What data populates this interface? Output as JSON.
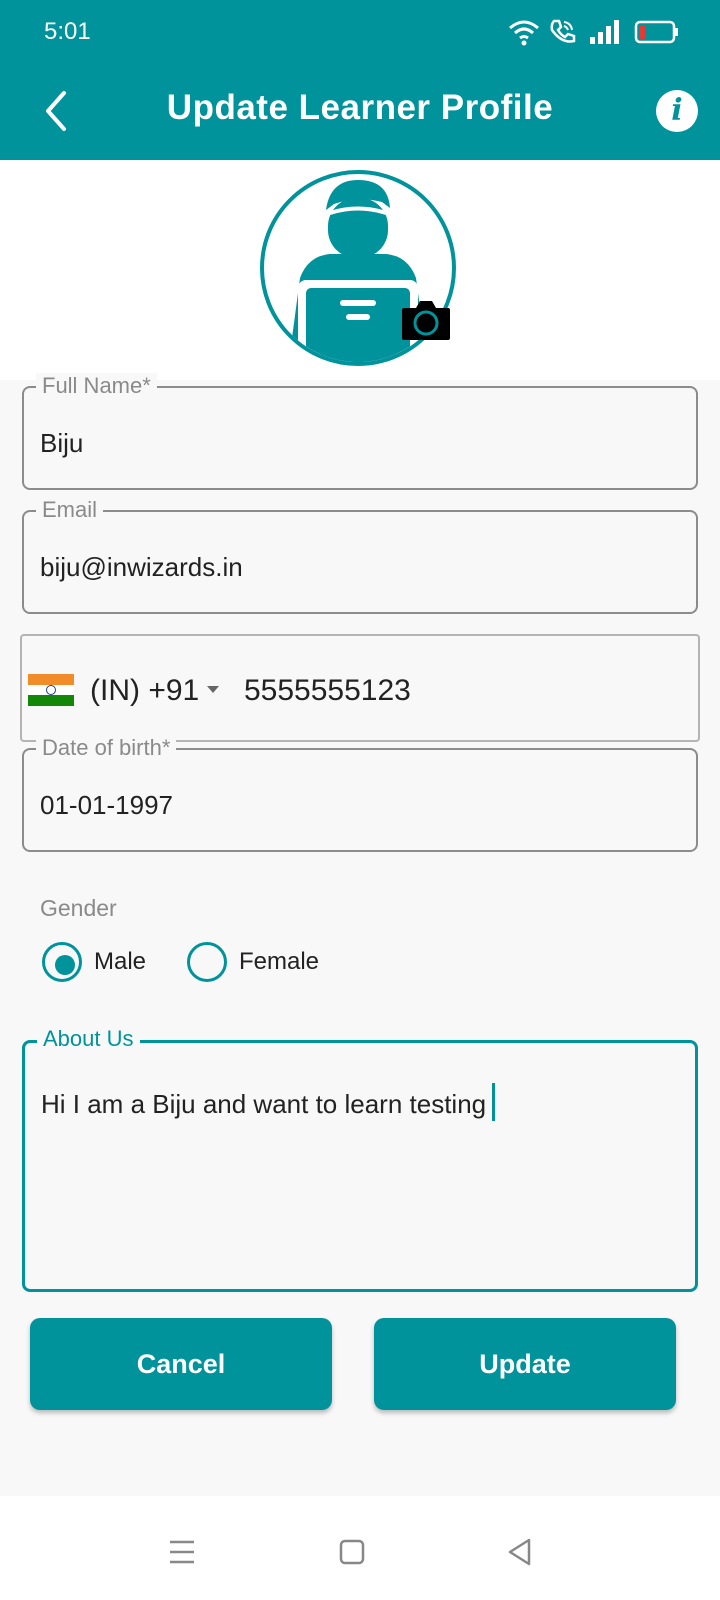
{
  "status_bar": {
    "time": "5:01",
    "icons": [
      "wifi-icon",
      "call-icon",
      "signal-icon",
      "battery-low-icon"
    ]
  },
  "header": {
    "back_icon": "chevron-left-icon",
    "title": "Update Learner Profile",
    "info_icon": "info-icon",
    "info_glyph": "i"
  },
  "profile": {
    "avatar_icon": "user-with-laptop-icon",
    "camera_icon": "camera-icon"
  },
  "form": {
    "full_name": {
      "label": "Full Name*",
      "value": "Biju"
    },
    "email": {
      "label": "Email",
      "value": "biju@inwizards.in"
    },
    "phone": {
      "flag_icon": "india-flag-icon",
      "country_code": "(IN) +91",
      "number": "5555555123"
    },
    "dob": {
      "label": "Date of birth*",
      "value": "01-01-1997"
    },
    "gender": {
      "label": "Gender",
      "options": [
        {
          "label": "Male",
          "selected": true
        },
        {
          "label": "Female",
          "selected": false
        }
      ]
    },
    "about": {
      "label": "About Us",
      "value": "Hi I am a Biju and want to learn testing"
    }
  },
  "actions": {
    "cancel_label": "Cancel",
    "update_label": "Update"
  },
  "nav_bar": {
    "icons": [
      "menu-icon",
      "home-square-icon",
      "back-triangle-icon"
    ]
  },
  "colors": {
    "accent": "#00939b",
    "background": "#f8f8f8",
    "border": "#8c8c8c"
  }
}
